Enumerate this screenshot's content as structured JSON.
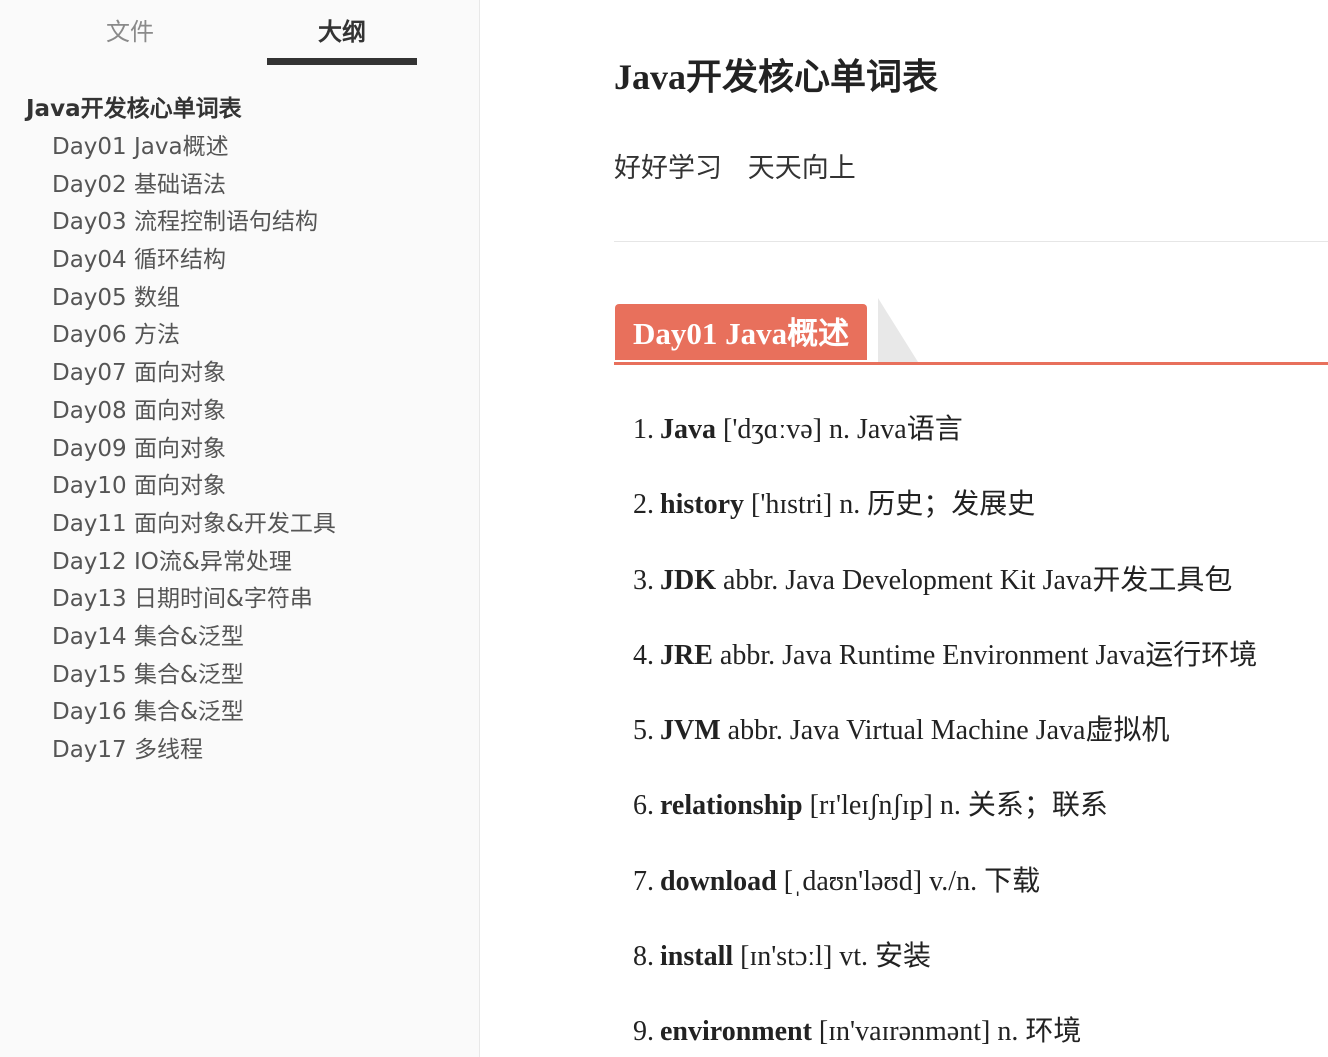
{
  "sidebar": {
    "tabs": {
      "files": "文件",
      "outline": "大纲"
    },
    "outline_root": "Java开发核心单词表",
    "items": [
      "Day01 Java概述",
      "Day02 基础语法",
      "Day03 流程控制语句结构",
      "Day04 循环结构",
      "Day05 数组",
      "Day06 方法",
      "Day07 面向对象",
      "Day08 面向对象",
      "Day09 面向对象",
      "Day10 面向对象",
      "Day11 面向对象&开发工具",
      "Day12 IO流&异常处理",
      "Day13 日期时间&字符串",
      "Day14 集合&泛型",
      "Day15 集合&泛型",
      "Day16 集合&泛型",
      "Day17 多线程"
    ]
  },
  "doc": {
    "title": "Java开发核心单词表",
    "subtitle": "好好学习   天天向上",
    "section_heading": "Day01 Java概述",
    "accent_color": "#e8705c",
    "words": [
      {
        "num": "1.",
        "term": "Java",
        "rest": " ['dʒɑːvə] n. Java语言"
      },
      {
        "num": "2.",
        "term": "history",
        "rest": " ['hɪstri] n. 历史；发展史"
      },
      {
        "num": "3.",
        "term": "JDK",
        "rest": " abbr. Java Development Kit Java开发工具包"
      },
      {
        "num": "4.",
        "term": "JRE",
        "rest": " abbr. Java Runtime Environment Java运行环境"
      },
      {
        "num": "5.",
        "term": "JVM",
        "rest": " abbr. Java Virtual Machine Java虚拟机"
      },
      {
        "num": "6.",
        "term": "relationship",
        "rest": " [rɪ'leɪʃnʃɪp] n. 关系；联系"
      },
      {
        "num": "7.",
        "term": "download",
        "rest": " [ˌdaʊn'ləʊd] v./n. 下载"
      },
      {
        "num": "8.",
        "term": "install",
        "rest": " [ɪn'stɔːl] vt. 安装"
      },
      {
        "num": "9.",
        "term": "environment",
        "rest": " [ɪn'vaɪrənmənt] n. 环境"
      }
    ]
  }
}
